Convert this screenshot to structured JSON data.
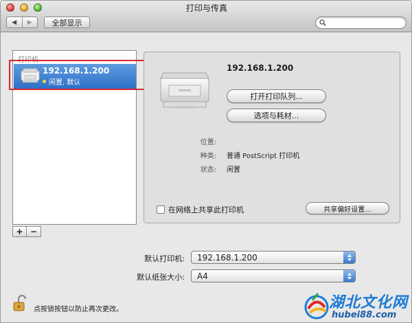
{
  "window": {
    "title": "打印与传真"
  },
  "toolbar": {
    "back_icon": "back-arrow",
    "forward_icon": "forward-arrow",
    "show_all_label": "全部显示",
    "search_placeholder": ""
  },
  "sidebar": {
    "header": "打印机",
    "printers": [
      {
        "name": "192.168.1.200",
        "status": "闲置, 默认",
        "status_color": "#f2d64a",
        "selected": true
      }
    ],
    "add_label": "+",
    "remove_label": "−"
  },
  "detail": {
    "printer_name": "192.168.1.200",
    "open_queue_label": "打开打印队列...",
    "options_label": "选项与耗材...",
    "info": [
      {
        "label": "位置:",
        "value": ""
      },
      {
        "label": "种类:",
        "value": "普通 PostScript 打印机"
      },
      {
        "label": "状态:",
        "value": "闲置"
      }
    ],
    "share_label": "在网络上共享此打印机",
    "share_checked": false,
    "sharing_prefs_label": "共享偏好设置..."
  },
  "defaults": {
    "printer_label": "默认打印机:",
    "printer_value": "192.168.1.200",
    "paper_label": "默认纸张大小:",
    "paper_value": "A4"
  },
  "footer": {
    "lock_text": "点按锁按钮以防止再次更改。"
  },
  "watermark": {
    "text": "湖北文化网",
    "sub": "hubei88.com"
  },
  "colors": {
    "selection": "#2d6fc6",
    "highlight_box": "#d8262f",
    "popup_accent": "#3a79cf"
  }
}
